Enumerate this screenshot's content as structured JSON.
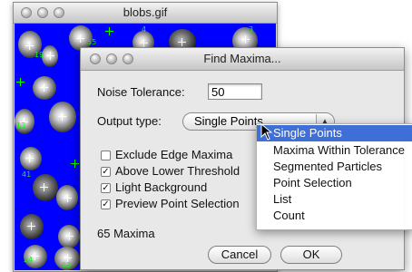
{
  "back_window": {
    "title": "blobs.gif"
  },
  "canvas_labels": [
    "55",
    "19",
    "4",
    "3",
    "13",
    "41",
    "24",
    "63"
  ],
  "dialog": {
    "title": "Find Maxima...",
    "noise_tolerance_label": "Noise Tolerance:",
    "noise_tolerance_value": "50",
    "output_type_label": "Output type:",
    "output_type_value": "Single Points",
    "checkboxes": [
      {
        "label": "Exclude Edge Maxima",
        "checked": false
      },
      {
        "label": "Above Lower Threshold",
        "checked": true
      },
      {
        "label": "Light Background",
        "checked": true
      },
      {
        "label": "Preview Point Selection",
        "checked": true
      }
    ],
    "status": "65 Maxima",
    "cancel_label": "Cancel",
    "ok_label": "OK"
  },
  "output_menu": {
    "items": [
      {
        "label": "Single Points",
        "selected": true,
        "check": "✓"
      },
      {
        "label": "Maxima Within Tolerance",
        "selected": false
      },
      {
        "label": "Segmented Particles",
        "selected": false
      },
      {
        "label": "Point Selection",
        "selected": false
      },
      {
        "label": "List",
        "selected": false
      },
      {
        "label": "Count",
        "selected": false
      }
    ]
  },
  "colors": {
    "canvas_blue": "#0000ff",
    "point_green": "#00ff00",
    "menu_highlight": "#3d6fd6"
  }
}
